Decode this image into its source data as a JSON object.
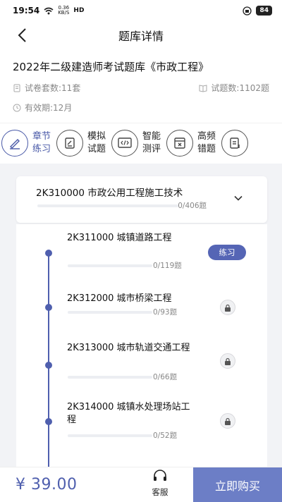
{
  "status_bar": {
    "time": "19:54",
    "net_speed_top": "0.36",
    "net_speed_bottom": "KB/S",
    "hd": "HD",
    "battery": "84"
  },
  "nav": {
    "title": "题库详情"
  },
  "exam": {
    "title": "2022年二级建造师考试题库《市政工程》",
    "paper_count": "试卷套数:11套",
    "question_count": "试题数:1102题",
    "validity": "有效期:12月"
  },
  "modes": [
    {
      "label": "章节练习",
      "icon": "pen-icon",
      "active": true
    },
    {
      "label": "模拟试题",
      "icon": "edit-paper-icon",
      "active": false
    },
    {
      "label": "智能测评",
      "icon": "code-icon",
      "active": false
    },
    {
      "label": "高频错题",
      "icon": "wrong-paper-icon",
      "active": false
    },
    {
      "label": "",
      "icon": "notes-icon",
      "active": false
    }
  ],
  "chapter": {
    "title": "2K310000 市政公用工程施工技术",
    "count": "0/406题",
    "progress": 0
  },
  "sections": [
    {
      "title": "2K311000 城镇道路工程",
      "count": "0/119题",
      "progress": 0,
      "action": "练习",
      "locked": false
    },
    {
      "title": "2K312000 城市桥梁工程",
      "count": "0/93题",
      "progress": 0,
      "locked": true
    },
    {
      "title": "2K313000 城市轨道交通工程",
      "count": "0/66题",
      "progress": 0,
      "locked": true
    },
    {
      "title": "2K314000 城镇水处理场站工程",
      "count": "0/52题",
      "progress": 0,
      "locked": true
    }
  ],
  "bottom": {
    "price": "¥ 39.00",
    "service_label": "客服",
    "buy_label": "立即购买"
  },
  "colors": {
    "accent": "#4f5fae",
    "buy_button": "#6c7ec6",
    "background": "#f2f3f6"
  }
}
